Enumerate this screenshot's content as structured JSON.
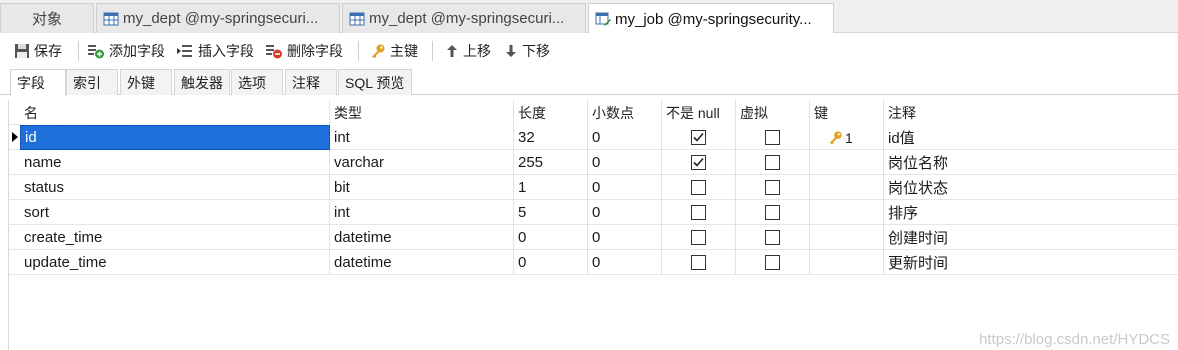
{
  "window_tabs": [
    {
      "label": "对象"
    },
    {
      "label": "my_dept @my-springsecuri..."
    },
    {
      "label": "my_dept @my-springsecuri..."
    },
    {
      "label": "my_job @my-springsecurity..."
    }
  ],
  "toolbar": {
    "save": "保存",
    "add_field": "添加字段",
    "insert_field": "插入字段",
    "delete_field": "删除字段",
    "primary_key": "主键",
    "move_up": "上移",
    "move_down": "下移"
  },
  "sub_tabs": [
    "字段",
    "索引",
    "外键",
    "触发器",
    "选项",
    "注释",
    "SQL 预览"
  ],
  "grid": {
    "headers": {
      "name": "名",
      "type": "类型",
      "length": "长度",
      "decimals": "小数点",
      "not_null": "不是 null",
      "virtual": "虚拟",
      "key": "键",
      "comment": "注释"
    },
    "rows": [
      {
        "name": "id",
        "type": "int",
        "length": "32",
        "decimals": "0",
        "not_null": true,
        "virtual": false,
        "key": "1",
        "comment": "id值"
      },
      {
        "name": "name",
        "type": "varchar",
        "length": "255",
        "decimals": "0",
        "not_null": true,
        "virtual": false,
        "key": "",
        "comment": "岗位名称"
      },
      {
        "name": "status",
        "type": "bit",
        "length": "1",
        "decimals": "0",
        "not_null": false,
        "virtual": false,
        "key": "",
        "comment": "岗位状态"
      },
      {
        "name": "sort",
        "type": "int",
        "length": "5",
        "decimals": "0",
        "not_null": false,
        "virtual": false,
        "key": "",
        "comment": "排序"
      },
      {
        "name": "create_time",
        "type": "datetime",
        "length": "0",
        "decimals": "0",
        "not_null": false,
        "virtual": false,
        "key": "",
        "comment": "创建时间"
      },
      {
        "name": "update_time",
        "type": "datetime",
        "length": "0",
        "decimals": "0",
        "not_null": false,
        "virtual": false,
        "key": "",
        "comment": "更新时间"
      }
    ]
  },
  "watermark": "https://blog.csdn.net/HYDCS",
  "icons": {
    "table": "table-icon",
    "save": "save-icon",
    "add_field": "add-field-icon",
    "insert_field": "insert-field-icon",
    "delete_field": "delete-field-icon",
    "primary_key": "key-icon",
    "move_up": "arrow-up-icon",
    "move_down": "arrow-down-icon"
  },
  "colors": {
    "selection": "#1e6fd9",
    "key": "#e0a020"
  }
}
